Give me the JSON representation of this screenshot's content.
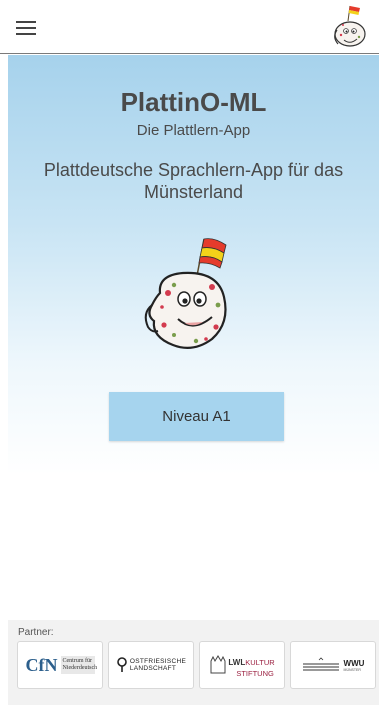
{
  "topbar": {
    "menu_icon": "hamburger-menu-icon",
    "logo_icon": "plattino-mascot-icon"
  },
  "hero": {
    "title": "PlattinO-ML",
    "subtitle": "Die Plattlern-App",
    "tagline": "Plattdeutsche Sprachlern-App für das Münsterland",
    "mascot_icon": "plattino-mascot-icon",
    "level_button_label": "Niveau A1"
  },
  "partners": {
    "label": "Partner:",
    "items": [
      {
        "letters": "CfN",
        "text": "Centrum für Niederdeutsch"
      },
      {
        "text_line1": "OSTFRIESISCHE",
        "text_line2": "LANDSCHAFT"
      },
      {
        "text_line1": "LWL",
        "text_line2": "KULTUR",
        "text_line3": "STIFTUNG"
      },
      {
        "text": "WWU",
        "sub": "MÜNSTER"
      }
    ]
  },
  "colors": {
    "gradient_top": "#a6d2ec",
    "button_bg": "#a6d4ee",
    "footer_bg": "#f2f2f2",
    "lwl_accent": "#9b2040"
  }
}
